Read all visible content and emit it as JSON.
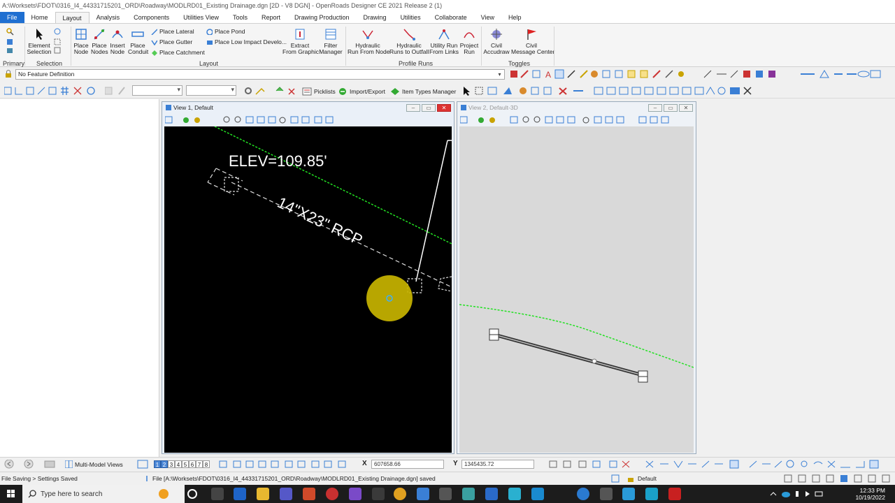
{
  "window": {
    "title": "A:\\Worksets\\FDOT\\0316_I4_44331715201_ORD\\Roadway\\MODLRD01_Existing Drainage.dgn [2D - V8 DGN] - OpenRoads Designer CE 2021 Release 2 (1)"
  },
  "menu": {
    "tabs": [
      "File",
      "Home",
      "Layout",
      "Analysis",
      "Components",
      "Utilities View",
      "Tools",
      "Report",
      "Drawing Production",
      "Drawing",
      "Utilities",
      "Collaborate",
      "View",
      "Help"
    ],
    "active": "Layout"
  },
  "ribbon": {
    "primary_label": "Primary",
    "selection": {
      "label": "Selection",
      "element_selection": "Element\nSelection"
    },
    "layout": {
      "label": "Layout",
      "place_node": "Place\nNode",
      "place_nodes": "Place\nNodes",
      "insert_node": "Insert\nNode",
      "place_conduit": "Place\nConduit",
      "place_lateral": "Place Lateral",
      "place_gutter": "Place Gutter",
      "place_catchment": "Place Catchment",
      "place_pond": "Place Pond",
      "place_low_impact": "Place Low Impact Develo...",
      "extract_from_graphic": "Extract\nFrom Graphic",
      "filter_manager": "Filter\nManager"
    },
    "profile_runs": {
      "label": "Profile Runs",
      "hydraulic_run_from_node": "Hydraulic\nRun From Node",
      "hydraulic_runs_to_outfall": "Hydraulic\nRuns to Outfall",
      "utility_run_from_links": "Utility Run\nFrom Links",
      "project_run": "Project\nRun"
    },
    "toggles": {
      "label": "Toggles",
      "civil_accudraw": "Civil\nAccudraw",
      "civil_message_center": "Civil\nMessage Center"
    }
  },
  "feature": {
    "value": "No Feature Definition"
  },
  "toolbar": {
    "picklists": "Picklists",
    "import_export": "Import/Export",
    "item_types_manager": "Item Types Manager"
  },
  "view1": {
    "title": "View 1, Default",
    "elev_label": "ELEV=109.85'",
    "pipe_label": "14\"X23\" RCP"
  },
  "view2": {
    "title": "View 2, Default-3D"
  },
  "bottom": {
    "multi_model_views": "Multi-Model Views",
    "view_numbers": [
      "1",
      "2",
      "3",
      "4",
      "5",
      "6",
      "7",
      "8"
    ],
    "x_label": "X",
    "x_value": "607658.66",
    "y_label": "Y",
    "y_value": "1345435.72"
  },
  "status": {
    "left": "File Saving > Settings Saved",
    "message": "File [A:\\Worksets\\FDOT\\0316_I4_44331715201_ORD\\Roadway\\MODLRD01_Existing Drainage.dgn] saved",
    "level": "Default"
  },
  "taskbar": {
    "search_placeholder": "Type here to search",
    "time": "12:33 PM",
    "date": "10/19/2022"
  },
  "colors": {
    "accent": "#1f6fd1",
    "canvas_black": "#000000",
    "canvas_grey": "#d9d9d9",
    "green_line": "#22e022",
    "highlight": "#c8b400"
  }
}
